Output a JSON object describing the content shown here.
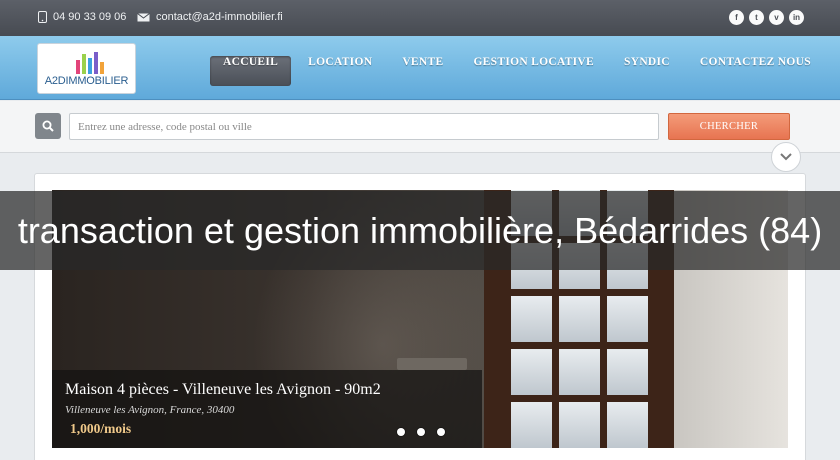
{
  "topbar": {
    "phone": "04 90 33 09 06",
    "email": "contact@a2d-immobilier.fi",
    "social_icons": [
      "facebook-icon",
      "twitter-icon",
      "vimeo-icon",
      "linkedin-icon"
    ],
    "social_glyphs": [
      "f",
      "t",
      "v",
      "in"
    ]
  },
  "logo": {
    "text": "A2DIMMOBILIER"
  },
  "nav": {
    "items": [
      {
        "label": "ACCUEIL",
        "active": true
      },
      {
        "label": "LOCATION"
      },
      {
        "label": "VENTE"
      },
      {
        "label": "GESTION LOCATIVE"
      },
      {
        "label": "SYNDIC"
      },
      {
        "label": "CONTACTEZ NOUS"
      }
    ]
  },
  "search": {
    "placeholder": "Entrez une adresse, code postal ou ville",
    "button_label": "CHERCHER"
  },
  "listing": {
    "title": "Maison 4 pièces - Villeneuve les Avignon - 90m2",
    "location": "Villeneuve les Avignon, France, 30400",
    "price": "1,000/mois"
  },
  "banner": {
    "title": "transaction et gestion immobilière, Bédarrides (84)"
  },
  "colors": {
    "accent": "#e77451",
    "header": "#5fa9da",
    "topbar": "#474b52"
  }
}
